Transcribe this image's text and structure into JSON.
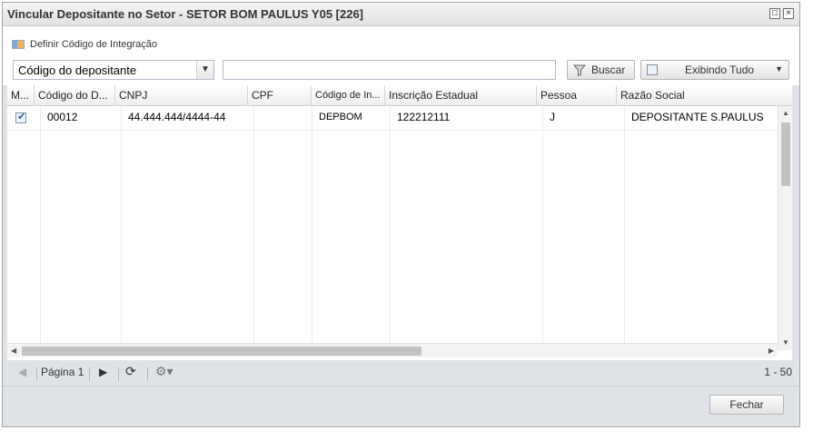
{
  "window": {
    "title": "Vincular Depositante no Setor - SETOR BOM PAULUS Y05 [226]",
    "maximize_glyph": "□",
    "close_glyph": "×"
  },
  "toolbar": {
    "integration_label": "Definir Código de Integração"
  },
  "filter": {
    "field_selected": "Código do depositante",
    "search_value": "",
    "search_label": "Buscar",
    "display_label": "Exibindo Tudo"
  },
  "grid": {
    "columns": [
      "M...",
      "Código do D...",
      "CNPJ",
      "CPF",
      "Código de In...",
      "Inscrição Estadual",
      "Pessoa",
      "Razão Social"
    ],
    "rows": [
      {
        "selected": true,
        "codigo": "00012",
        "cnpj": "44.444.444/4444-44",
        "cpf": "",
        "codigo_integracao": "DEPBOM",
        "inscricao_estadual": "122212111",
        "pessoa": "J",
        "razao_social": "DEPOSITANTE S.PAULUS"
      }
    ]
  },
  "pager": {
    "page_label": "Página 1",
    "range": "1 - 50"
  },
  "footer": {
    "close_label": "Fechar"
  },
  "icons": [
    "integration-icon",
    "chevron-down-icon",
    "filter-icon",
    "display-mode-icon",
    "caret-down-icon",
    "checkmark-icon",
    "prev-page-icon",
    "next-page-icon",
    "refresh-icon",
    "gear-icon",
    "maximize-icon",
    "close-icon"
  ]
}
